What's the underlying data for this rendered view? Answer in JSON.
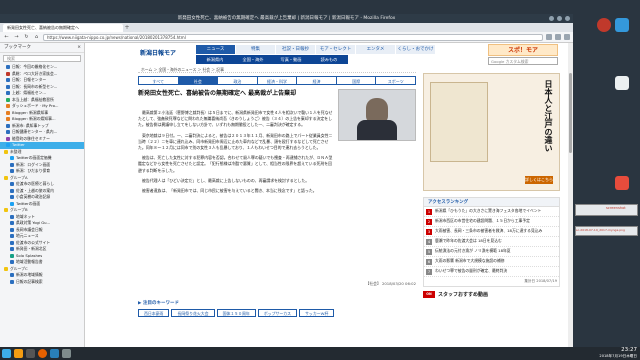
{
  "window": {
    "title": "新発田女性死亡、喜納被告の無期確定へ 最高裁が上告棄却 | 新潟日報モア | 新潟日報モア - Mozilla Firefox",
    "tab_label": "新発田女性死亡、喜納被告の無期確定へ",
    "url": "https://www.niigata-nippo.co.jp/news/national/20180201378754.html"
  },
  "sidebar": {
    "header": "ブックマーク",
    "search_placeholder": "検索",
    "items": [
      {
        "label": "日報：今回の厳格化セン...",
        "type": "item",
        "color": "#2c6fbf"
      },
      {
        "label": "県総：ペロ大好き家族会...",
        "type": "item",
        "color": "#c0392b"
      },
      {
        "label": "日報：日報センター",
        "type": "item",
        "color": "#2c6fbf"
      },
      {
        "label": "日報：長岡市の新型セン...",
        "type": "item",
        "color": "#2c6fbf"
      },
      {
        "label": "上越：県福祉セン...",
        "type": "item",
        "color": "#2c6fbf"
      },
      {
        "label": "本当上越：県福祉教習所",
        "type": "item",
        "color": "#27ae60"
      },
      {
        "label": "ダッシュボード · My Pro...",
        "type": "item",
        "color": "#e67e22"
      },
      {
        "label": "Blogger: 新潟県知事",
        "type": "item",
        "color": "#e67e22"
      },
      {
        "label": "Blogger: 新潟の県知事...",
        "type": "item",
        "color": "#e67e22"
      },
      {
        "label": "新潟市: 県知事トップ",
        "type": "item",
        "color": "#2c6fbf"
      },
      {
        "label": "日報健康センター · 県内...",
        "type": "item",
        "color": "#2c6fbf"
      },
      {
        "label": "能登町の移住セミナー",
        "type": "item",
        "color": "#8e44ad"
      },
      {
        "label": "Twitter",
        "type": "selected",
        "color": "#1da1f2"
      },
      {
        "label": "未整理",
        "type": "folder",
        "color": "#f1c40f"
      },
      {
        "label": "Twitterの画面定価機",
        "type": "item",
        "color": "#1da1f2"
      },
      {
        "label": "新潟：ログイン画面",
        "type": "item",
        "color": "#2c6fbf"
      },
      {
        "label": "新潟：ひだまり保育",
        "type": "item",
        "color": "#2c6fbf"
      },
      {
        "label": "グループA",
        "type": "folder",
        "color": "#f1c40f"
      },
      {
        "label": "佐渡市の医療と暮らし",
        "type": "item",
        "color": "#2c6fbf"
      },
      {
        "label": "佐渡・上越の旅の案内",
        "type": "item",
        "color": "#2c6fbf"
      },
      {
        "label": "小倉英樹の政治記録",
        "type": "item",
        "color": "#2c6fbf"
      },
      {
        "label": "Twitterの画面",
        "type": "item",
        "color": "#1da1f2"
      },
      {
        "label": "グループB",
        "type": "folder",
        "color": "#f1c40f"
      },
      {
        "label": "地域ネット",
        "type": "item",
        "color": "#2c6fbf"
      },
      {
        "label": "県政対策 Yogi Gu...",
        "type": "item",
        "color": "#2c6fbf"
      },
      {
        "label": "長岡市議会日報",
        "type": "item",
        "color": "#2c6fbf"
      },
      {
        "label": "地元ニュース",
        "type": "item",
        "color": "#2c6fbf"
      },
      {
        "label": "佐渡市の公式サイト",
        "type": "item",
        "color": "#2c6fbf"
      },
      {
        "label": "新発田・新潟北区",
        "type": "item",
        "color": "#2c6fbf"
      },
      {
        "label": "Solo Splashes",
        "type": "item",
        "color": "#16a085"
      },
      {
        "label": "地域活動報告書",
        "type": "item",
        "color": "#2c6fbf"
      },
      {
        "label": "グループC",
        "type": "folder",
        "color": "#f1c40f"
      },
      {
        "label": "新潟の地域情報",
        "type": "item",
        "color": "#2c6fbf"
      },
      {
        "label": "日報の記事検索",
        "type": "item",
        "color": "#2c6fbf"
      }
    ]
  },
  "site": {
    "logo": "新潟日報モア",
    "global_nav": [
      "ニュース",
      "特集",
      "社説・日報抄",
      "モア・セレクト",
      "エンタメ",
      "くらし・おでかけ"
    ],
    "sub_nav": [
      "新潟県内",
      "全国・海外",
      "写真・動画",
      "読みもの"
    ],
    "ad_banner": "スポ！モア",
    "search_placeholder": "Google カスタム検索",
    "breadcrumb": "ホーム ＞ 全国・海外のニュース ＞ 社会 ＞ 記事",
    "content_tabs": [
      "すべて",
      "社会",
      "政治",
      "経済・科学",
      "経済",
      "国際",
      "スポーツ"
    ],
    "active_tab": 1,
    "article": {
      "title": "新発田女性死亡、喜納被告の無期確定へ 最高裁が上告棄却",
      "paragraphs": [
        "最高裁第２小法廷（菅野博之裁判長）は５日までに、新潟県新発田市で女性４人を相次いで襲い１人を死なせたとして、強姦致死罪などに問われた無職喜納尚吾（きのうしょうご）被告（３４）の上告を棄却する決定をした。被告側は異議申し立てをしない方針で、いずれも無期懲役とした一、二審判決が確定する。",
        "東京地裁は９日付。一、二審判決によると、被告は２０１３年１１月、新発田市の路上でパート従業員女性＝当時（２２）＝を車に連れ込み、同市新発田市周辺に止めた車内などで乱暴、頭を殴打するなどして死亡させた。同年８〜１２月には同市で別の女性３人も乱暴しており、１人もわいせつ目的で連れ去らうとした。",
        "被告は、死亡した女性に対する犯罪内容を否認。合わせて殺人罪の疑いでも捜査・再逮捕されたが、ＤＮＡ型鑑定などから女性を死亡させたと認定。「犯行態様は冷酷で悪質」として、相当性の限界を超えている死刑を回避する判断を示した。",
        "被告代理人は「ひどい決定だ」とし、最高裁に上告しないものの、再審請求を検討するとした。",
        "被害者遺族は、「新発田市では、同じ市民に被害を与えていると聞き、本当に残念です」と語った。"
      ],
      "date": "【社会】 2018/03/20 06:02"
    },
    "keywords_title": "注目のキーワード",
    "keywords": [
      "西日本豪雨",
      "長岡祭り花火大会",
      "国体１５０周年",
      "ボップサーカス",
      "サッカーW杯"
    ],
    "ad_big": {
      "title": "日本人と江戸の違い",
      "button": "詳しくはこちら"
    },
    "ranking": {
      "title": "アクセスランキング",
      "items": [
        {
          "num": "1",
          "text": "新潟県「ひもうた」の大きさに驚き海フェスタ各地でイベント"
        },
        {
          "num": "2",
          "text": "新潟市西区の市営住宅の建設問題、１５日から工事予定"
        },
        {
          "num": "3",
          "text": "大雨被害、長岡・三条市の被害者を救済、18万に達する見込み"
        },
        {
          "num": "4",
          "text": "鹿瀬で昨年の佐渡大会は 18日を見込む"
        },
        {
          "num": "5",
          "text": "伝統漁法の元付き漁が ノリ漁を模範 18年夏"
        },
        {
          "num": "6",
          "text": "大雨の影響 新潟市で大規模な施設の補修"
        },
        {
          "num": "7",
          "text": "わいせつ罪で被告の量刑が確定、最終判決"
        }
      ],
      "date": "集計日 2018/07/19"
    },
    "staff_label": "スタッフおすすめ動画",
    "staff_badge": "ON AIR"
  },
  "taskbar": {
    "time": "23:27",
    "date": "2018年7月19日木曜日"
  },
  "desktop": {
    "window_label": "screenshot",
    "file_label": "sc-2018-07-19_2017-mynga.png"
  }
}
